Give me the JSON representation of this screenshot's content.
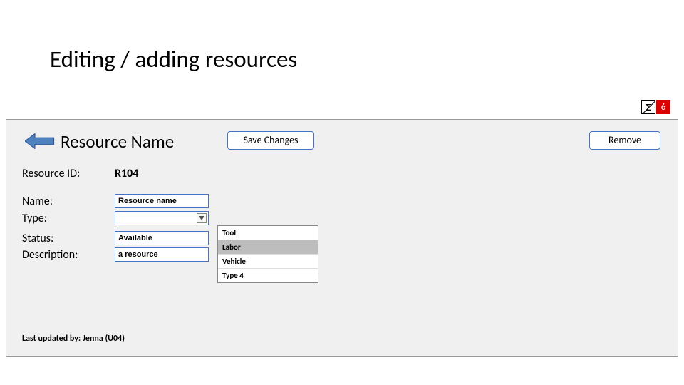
{
  "page": {
    "title": "Editing / adding resources"
  },
  "panel": {
    "heading": "Resource Name",
    "save_label": "Save Changes",
    "remove_label": "Remove"
  },
  "popup": {
    "icon_glyph": "Σ",
    "count": "6"
  },
  "fields": {
    "id": {
      "label": "Resource ID:",
      "value": "R104"
    },
    "name": {
      "label": "Name:",
      "value": "Resource name"
    },
    "type": {
      "label": "Type:",
      "value": ""
    },
    "status": {
      "label": "Status:",
      "value": "Available"
    },
    "desc": {
      "label": "Description:",
      "value": "a resource"
    }
  },
  "dropdown": {
    "options": [
      {
        "label": "Tool",
        "selected": false
      },
      {
        "label": "Labor",
        "selected": true
      },
      {
        "label": "Vehicle",
        "selected": false
      },
      {
        "label": "Type 4",
        "selected": false
      }
    ]
  },
  "footer": {
    "updated_by": "Last updated by: Jenna (U04)"
  }
}
